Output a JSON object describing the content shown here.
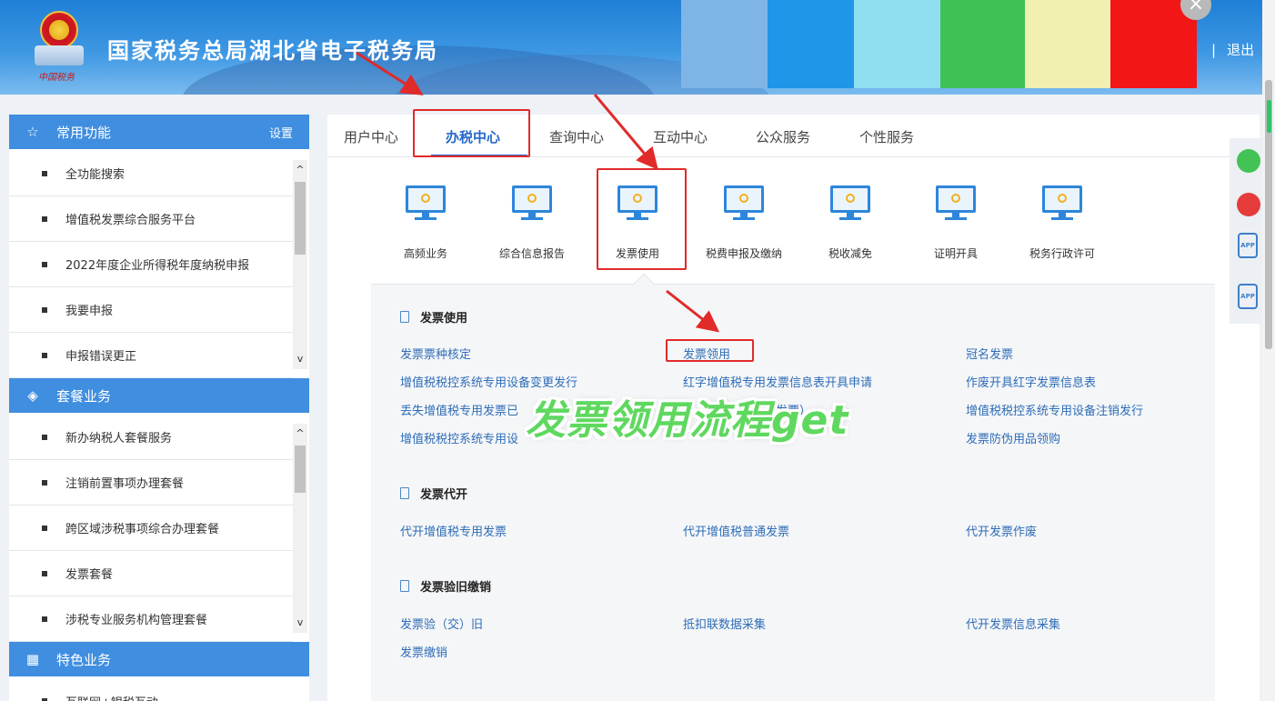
{
  "header": {
    "site_title": "国家税务总局湖北省电子税务局",
    "logo_script": "中国税务",
    "logout": "退出",
    "logout_sep": "|",
    "close_symbol": "×",
    "swatches": [
      "#7fb5e6",
      "#1f96e8",
      "#8fdff1",
      "#3fc157",
      "#f2efb3",
      "#f21616"
    ]
  },
  "sidebar": {
    "common": {
      "title": "常用功能",
      "settings": "设置",
      "items": [
        "全功能搜索",
        "增值税发票综合服务平台",
        "2022年度企业所得税年度纳税申报",
        "我要申报",
        "申报错误更正"
      ]
    },
    "package": {
      "title": "套餐业务",
      "items": [
        "新办纳税人套餐服务",
        "注销前置事项办理套餐",
        "跨区域涉税事项综合办理套餐",
        "发票套餐",
        "涉税专业服务机构管理套餐"
      ]
    },
    "special": {
      "title": "特色业务",
      "partial_item": "互联网+银税互动"
    }
  },
  "tabs": [
    "用户中心",
    "办税中心",
    "查询中心",
    "互动中心",
    "公众服务",
    "个性服务"
  ],
  "services": [
    "高频业务",
    "综合信息报告",
    "发票使用",
    "税费申报及缴纳",
    "税收减免",
    "证明开具",
    "税务行政许可"
  ],
  "groups": {
    "use": {
      "title": "发票使用",
      "links": [
        "发票票种核定",
        "发票领用",
        "冠名发票",
        "增值税税控系统专用设备变更发行",
        "红字增值税专用发票信息表开具申请",
        "作废开具红字发票信息表",
        "丢失增值税专用发票已",
        "用发票）",
        "增值税税控系统专用设备注销发行",
        "增值税税控系统专用设",
        "发票防伪用品领购"
      ]
    },
    "agent": {
      "title": "发票代开",
      "links": [
        "代开增值税专用发票",
        "代开增值税普通发票",
        "代开发票作废"
      ]
    },
    "verify": {
      "title": "发票验旧缴销",
      "links": [
        "发票验（交）旧",
        "抵扣联数据采集",
        "代开发票信息采集",
        "发票缴销"
      ]
    }
  },
  "overlay_caption": "发票领用流程get",
  "float_icons": [
    "wechat-icon",
    "weibo-icon",
    "app-icon",
    "app-icon"
  ],
  "app_label": "APP",
  "accent": "#2569c7",
  "annotation_color": "#e12a2a"
}
